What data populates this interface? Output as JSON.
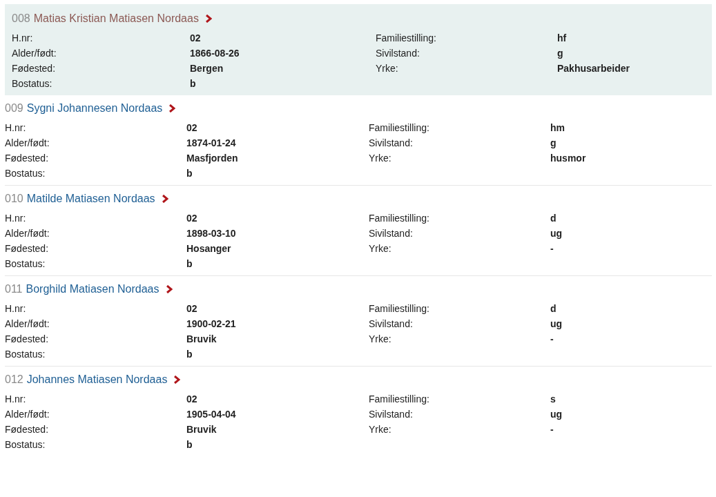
{
  "persons": [
    {
      "number": "008",
      "name": "Matias Kristian Matiasen Nordaas",
      "selected": true,
      "left": [
        {
          "label": "H.nr:",
          "value": "02"
        },
        {
          "label": "Alder/født:",
          "value": "1866-08-26"
        },
        {
          "label": "Fødested:",
          "value": "Bergen"
        },
        {
          "label": "Bostatus:",
          "value": "b"
        }
      ],
      "right": [
        {
          "label": "Familiestilling:",
          "value": "hf"
        },
        {
          "label": "Sivilstand:",
          "value": "g"
        },
        {
          "label": "Yrke:",
          "value": "Pakhusarbeider"
        }
      ]
    },
    {
      "number": "009",
      "name": "Sygni Johannesen Nordaas",
      "selected": false,
      "left": [
        {
          "label": "H.nr:",
          "value": "02"
        },
        {
          "label": "Alder/født:",
          "value": "1874-01-24"
        },
        {
          "label": "Fødested:",
          "value": "Masfjorden"
        },
        {
          "label": "Bostatus:",
          "value": "b"
        }
      ],
      "right": [
        {
          "label": "Familiestilling:",
          "value": "hm"
        },
        {
          "label": "Sivilstand:",
          "value": "g"
        },
        {
          "label": "Yrke:",
          "value": "husmor"
        }
      ]
    },
    {
      "number": "010",
      "name": "Matilde Matiasen Nordaas",
      "selected": false,
      "left": [
        {
          "label": "H.nr:",
          "value": "02"
        },
        {
          "label": "Alder/født:",
          "value": "1898-03-10"
        },
        {
          "label": "Fødested:",
          "value": "Hosanger"
        },
        {
          "label": "Bostatus:",
          "value": "b"
        }
      ],
      "right": [
        {
          "label": "Familiestilling:",
          "value": "d"
        },
        {
          "label": "Sivilstand:",
          "value": "ug"
        },
        {
          "label": "Yrke:",
          "value": "-"
        }
      ]
    },
    {
      "number": "011",
      "name": "Borghild Matiasen Nordaas",
      "selected": false,
      "left": [
        {
          "label": "H.nr:",
          "value": "02"
        },
        {
          "label": "Alder/født:",
          "value": "1900-02-21"
        },
        {
          "label": "Fødested:",
          "value": "Bruvik"
        },
        {
          "label": "Bostatus:",
          "value": "b"
        }
      ],
      "right": [
        {
          "label": "Familiestilling:",
          "value": "d"
        },
        {
          "label": "Sivilstand:",
          "value": "ug"
        },
        {
          "label": "Yrke:",
          "value": "-"
        }
      ]
    },
    {
      "number": "012",
      "name": "Johannes Matiasen Nordaas",
      "selected": false,
      "left": [
        {
          "label": "H.nr:",
          "value": "02"
        },
        {
          "label": "Alder/født:",
          "value": "1905-04-04"
        },
        {
          "label": "Fødested:",
          "value": "Bruvik"
        },
        {
          "label": "Bostatus:",
          "value": "b"
        }
      ],
      "right": [
        {
          "label": "Familiestilling:",
          "value": "s"
        },
        {
          "label": "Sivilstand:",
          "value": "ug"
        },
        {
          "label": "Yrke:",
          "value": "-"
        }
      ]
    }
  ]
}
